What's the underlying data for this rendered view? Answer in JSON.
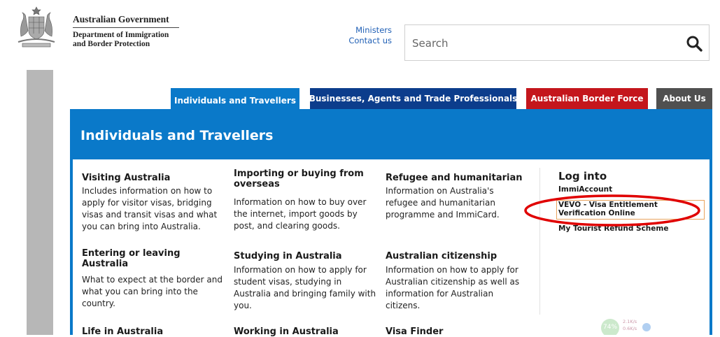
{
  "header": {
    "gov_title": "Australian Government",
    "dept_line1": "Department of Immigration",
    "dept_line2": "and Border Protection",
    "links": [
      "Ministers",
      "Contact us"
    ],
    "search_placeholder": "Search"
  },
  "tabs": [
    {
      "label": "Individuals and Travellers",
      "color": "#0a79c9"
    },
    {
      "label": "Businesses, Agents and Trade Professionals",
      "color": "#0c3d8c"
    },
    {
      "label": "Australian Border Force",
      "color": "#c4161c"
    },
    {
      "label": "About Us",
      "color": "#505050"
    }
  ],
  "section_title": "Individuals and Travellers",
  "columns": {
    "c1": [
      {
        "title": "Visiting Australia",
        "text": "Includes information on how to apply for visitor visas, bridging visas and transit visas and what you can bring into Australia."
      },
      {
        "title": "Entering or leaving Australia",
        "text": "What to expect at the border and what you can bring into the country."
      },
      {
        "title": "Life in Australia",
        "text": ""
      }
    ],
    "c2": [
      {
        "title": "Importing or buying from overseas",
        "text": "Information on how to buy over the internet, import goods by post, and clearing goods."
      },
      {
        "title": "Studying in Australia",
        "text": "Information on how to apply for student visas, studying in Australia and bringing family with you."
      },
      {
        "title": "Working in Australia",
        "text": ""
      }
    ],
    "c3": [
      {
        "title": "Refugee and humanitarian",
        "text": "Information on Australia's refugee and humanitarian programme and ImmiCard."
      },
      {
        "title": "Australian citizenship",
        "text": "Information on how to apply for Australian citizenship as well as information for Australian citizens."
      },
      {
        "title": "Visa Finder",
        "text": ""
      }
    ]
  },
  "login": {
    "heading": "Log into",
    "links": [
      "ImmiAccount",
      "VEVO - Visa Entitlement Verification Online",
      "My Tourist Refund Scheme"
    ]
  },
  "widget": {
    "percent": "74%",
    "line1": "2.1K/s",
    "line2": "0.6K/s"
  },
  "colors": {
    "accent_blue": "#0a79c9",
    "dark_blue": "#0c3d8c",
    "red": "#c4161c",
    "grey_tab": "#505050",
    "highlight_oval": "#e00000"
  }
}
